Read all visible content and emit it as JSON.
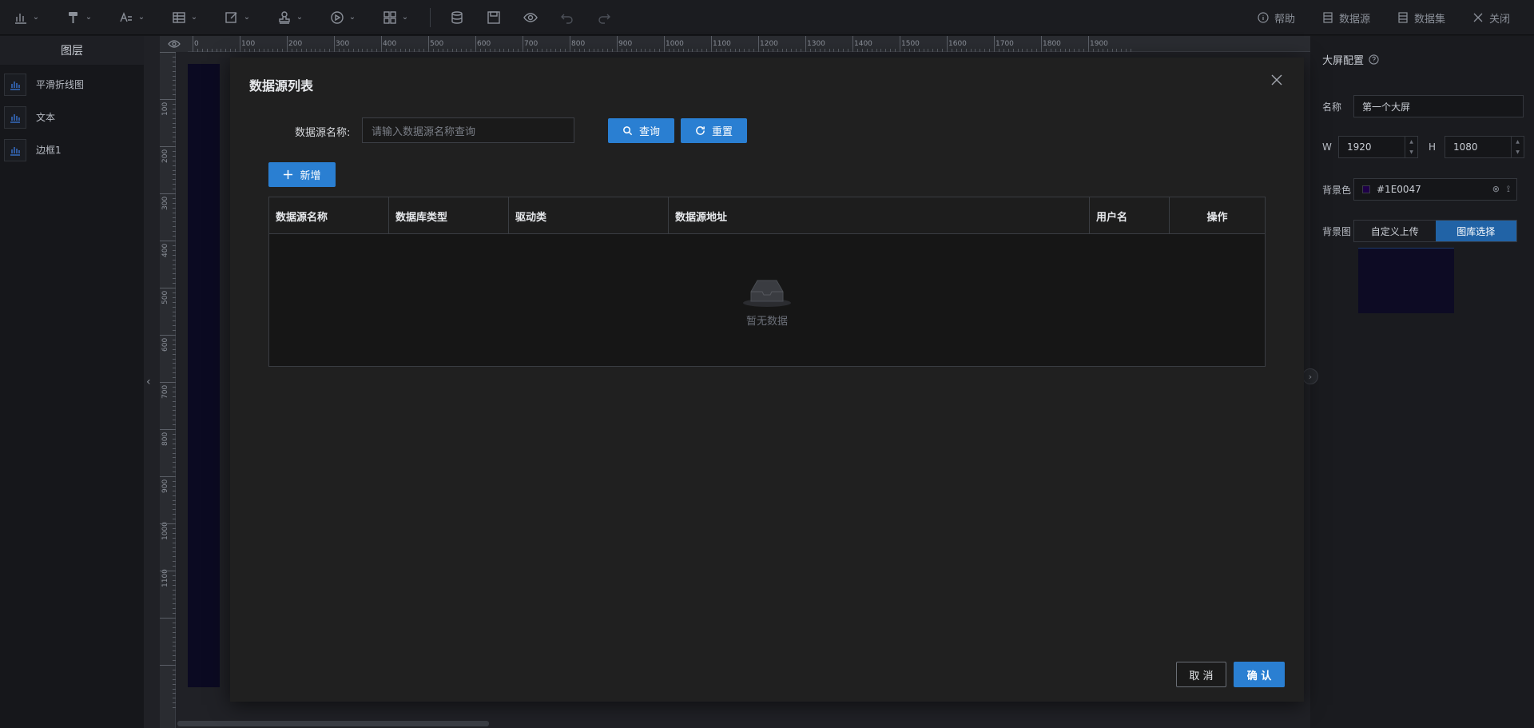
{
  "toolbar": {
    "groups": [
      "chart-icon",
      "brush-icon",
      "text-icon",
      "table-icon",
      "edit-icon",
      "stamp-icon",
      "media-icon",
      "grid-icon"
    ],
    "help": "帮助",
    "datasource": "数据源",
    "dataset": "数据集",
    "close": "关闭"
  },
  "layers": {
    "title": "图层",
    "items": [
      "平滑折线图",
      "文本",
      "边框1"
    ]
  },
  "ruler": {
    "h_ticks": [
      "0",
      "100",
      "200",
      "300",
      "400",
      "500",
      "600",
      "700",
      "800",
      "900",
      "1000",
      "1100",
      "1200",
      "1300",
      "1400",
      "1500",
      "1600",
      "1700",
      "1800",
      "1900"
    ],
    "v_ticks": [
      "100",
      "200",
      "300",
      "400",
      "500",
      "600",
      "700",
      "800",
      "900",
      "1000",
      "1100"
    ]
  },
  "config": {
    "title": "大屏配置",
    "name_label": "名称",
    "name_value": "第一个大屏",
    "w_label": "W",
    "w_value": "1920",
    "h_label": "H",
    "h_value": "1080",
    "bgcolor_label": "背景色",
    "bgcolor_value": "#1E0047",
    "bgimage_label": "背景图",
    "upload_label": "自定义上传",
    "gallery_label": "图库选择"
  },
  "modal": {
    "title": "数据源列表",
    "search_label": "数据源名称:",
    "search_placeholder": "请输入数据源名称查询",
    "query_button": "查询",
    "reset_button": "重置",
    "add_button": "新增",
    "columns": [
      "数据源名称",
      "数据库类型",
      "驱动类",
      "数据源地址",
      "用户名",
      "操作"
    ],
    "empty_text": "暂无数据",
    "cancel_button": "取 消",
    "confirm_button": "确 认"
  },
  "colors": {
    "accent": "#2a7fd2",
    "canvas_bg": "#1E0047"
  }
}
